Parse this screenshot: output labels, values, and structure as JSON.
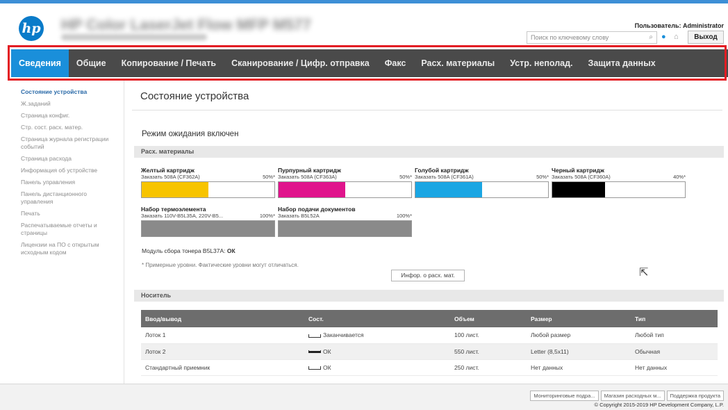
{
  "header": {
    "logo_text": "hp",
    "device_name": "HP Color LaserJet Flow MFP M577",
    "user_label": "Пользователь: Administrator",
    "search_placeholder": "Поиск по ключевому слову",
    "logout_label": "Выход",
    "icons": [
      "search-icon",
      "help-icon",
      "home-icon"
    ]
  },
  "nav": {
    "items": [
      {
        "label": "Сведения",
        "active": true
      },
      {
        "label": "Общие"
      },
      {
        "label": "Копирование / Печать"
      },
      {
        "label": "Сканирование / Цифр. отправка"
      },
      {
        "label": "Факс"
      },
      {
        "label": "Расх. материалы"
      },
      {
        "label": "Устр. неполад."
      },
      {
        "label": "Защита данных"
      }
    ],
    "highlight_color": "#e31c23",
    "active_color": "#1a8fda"
  },
  "sidebar": {
    "items": [
      {
        "label": "Состояние устройства",
        "active": true
      },
      {
        "label": "Ж.заданий"
      },
      {
        "label": "Страница конфиг."
      },
      {
        "label": "Стр. сост. расх. матер."
      },
      {
        "label": "Страница журнала регистрации событий"
      },
      {
        "label": "Страница расхода"
      },
      {
        "label": "Информация об устройстве"
      },
      {
        "label": "Панель управления"
      },
      {
        "label": "Панель дистанционного управления"
      },
      {
        "label": "Печать"
      },
      {
        "label": "Распечатываемые отчеты и страницы"
      },
      {
        "label": "Лицензии на ПО с открытым исходным кодом"
      }
    ]
  },
  "main": {
    "title": "Состояние устройства",
    "status": "Режим ожидания включен",
    "supplies_header": "Расх. материалы",
    "cartridges": [
      {
        "name": "Желтый картридж",
        "order": "Заказать 508A (CF362A)",
        "percent": "50%*",
        "level": 0.5,
        "color": "#f7c400"
      },
      {
        "name": "Пурпурный картридж",
        "order": "Заказать 508A (CF363A)",
        "percent": "50%*",
        "level": 0.5,
        "color": "#e0148c"
      },
      {
        "name": "Голубой картридж",
        "order": "Заказать 508A (CF361A)",
        "percent": "50%*",
        "level": 0.5,
        "color": "#1ba6e3"
      },
      {
        "name": "Черный картридж",
        "order": "Заказать 508A (CF360A)",
        "percent": "40%*",
        "level": 0.4,
        "color": "#000000"
      },
      {
        "name": "Набор термоэлемента",
        "order": "Заказать 110V-B5L35A, 220V-B5...",
        "percent": "100%*",
        "level": 1.0,
        "color": "#8a8a8a"
      },
      {
        "name": "Набор подачи документов",
        "order": "Заказать B5L52A",
        "percent": "100%*",
        "level": 1.0,
        "color": "#8a8a8a"
      }
    ],
    "toner_module_label": "Модуль сбора тонера B5L37A:",
    "toner_module_status": "ОК",
    "note": "* Примерные уровни. Фактические уровни могут отличаться.",
    "supplies_info_button": "Инфор. о расх. мат.",
    "media_header": "Носитель",
    "media_table": {
      "headers": [
        "Ввод/вывод",
        "Сост.",
        "Объем",
        "Размер",
        "Тип"
      ],
      "rows": [
        {
          "io": "Лоток 1",
          "status": "Заканчивается",
          "status_icon": "tray-empty-icon",
          "capacity": "100 лист.",
          "size": "Любой размер",
          "type": "Любой тип"
        },
        {
          "io": "Лоток 2",
          "status": "ОК",
          "status_icon": "tray-ok-icon",
          "capacity": "550 лист.",
          "size": "Letter (8,5x11)",
          "type": "Обычная"
        },
        {
          "io": "Стандартный приемник",
          "status": "ОК",
          "status_icon": "tray-empty-icon",
          "capacity": "250 лист.",
          "size": "Нет данных",
          "type": "Нет данных"
        }
      ]
    }
  },
  "footer": {
    "buttons": [
      "Мониторинговые подра...",
      "Магазин расходных м...",
      "Поддержка продукта"
    ],
    "copyright": "© Copyright 2015-2019 HP Development Company, L.P."
  }
}
